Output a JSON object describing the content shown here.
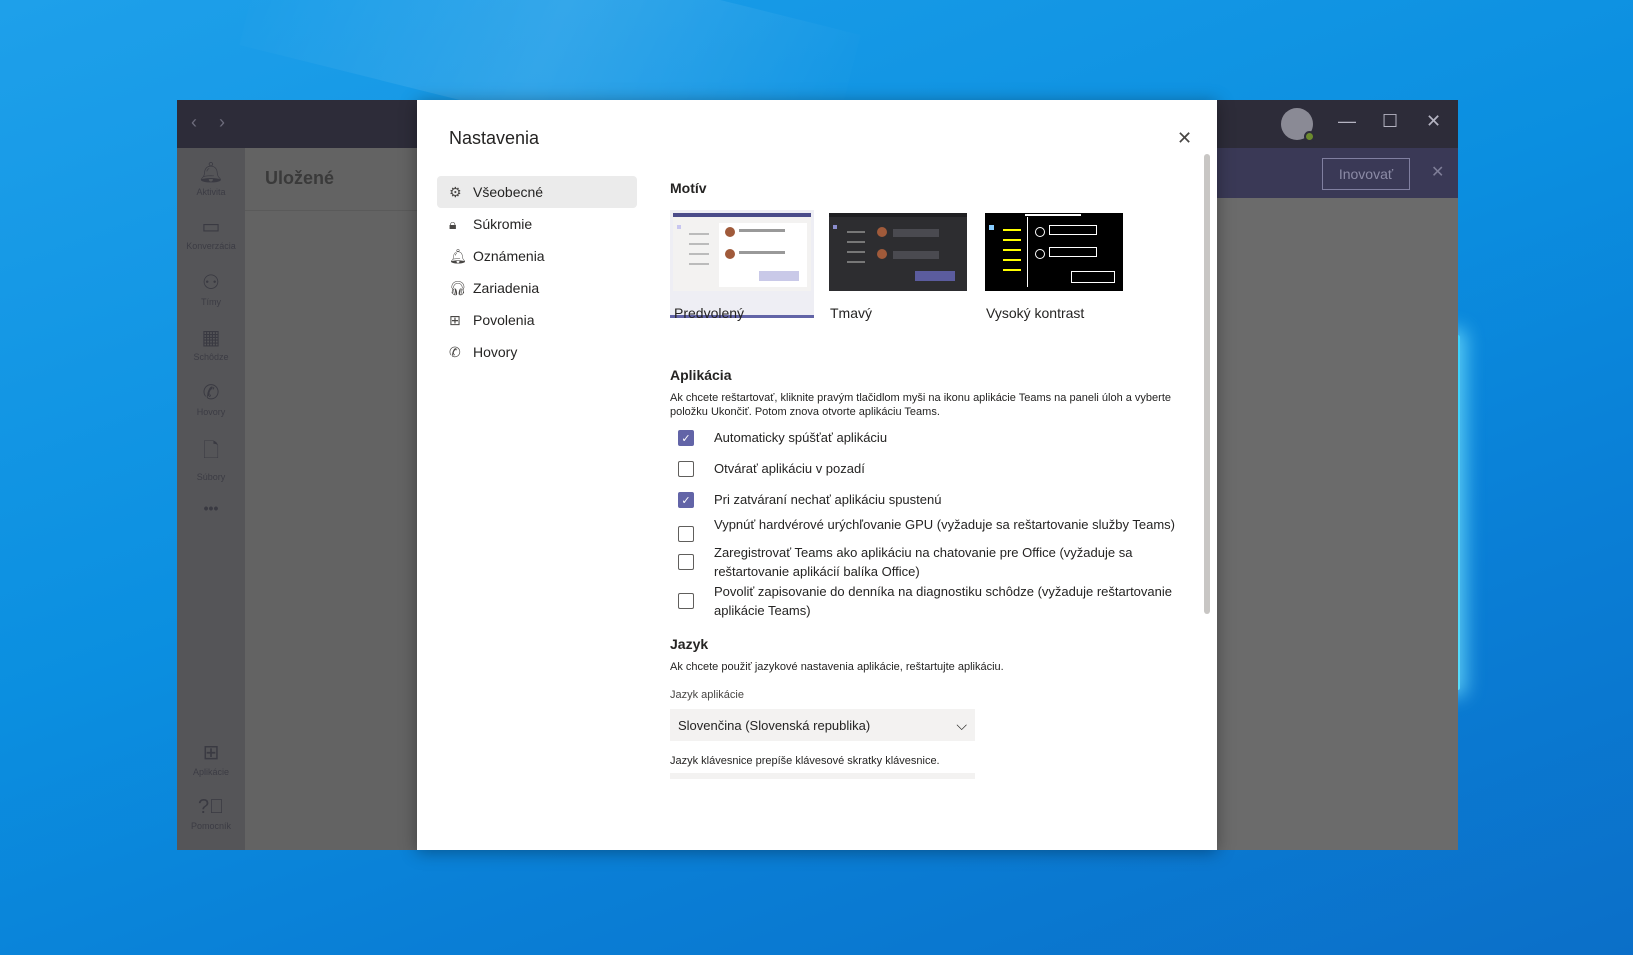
{
  "teams": {
    "rail": [
      {
        "label": "Aktivita",
        "icon": "bell-icon"
      },
      {
        "label": "Konverzácia",
        "icon": "chat-icon"
      },
      {
        "label": "Tímy",
        "icon": "teams-icon"
      },
      {
        "label": "Schôdze",
        "icon": "calendar-icon"
      },
      {
        "label": "Hovory",
        "icon": "phone-icon"
      },
      {
        "label": "Súbory",
        "icon": "file-icon"
      },
      {
        "label": "•••",
        "icon": "more-icon"
      }
    ],
    "rail_bottom": [
      {
        "label": "Aplikácie",
        "icon": "apps-icon"
      },
      {
        "label": "Pomocník",
        "icon": "help-icon"
      }
    ],
    "pane_title": "Uložené",
    "upgrade_label": "Inovovať"
  },
  "dialog": {
    "title": "Nastavenia",
    "nav": [
      {
        "label": "Všeobecné",
        "icon": "gear-icon",
        "active": true
      },
      {
        "label": "Súkromie",
        "icon": "lock-icon"
      },
      {
        "label": "Oznámenia",
        "icon": "bell-icon"
      },
      {
        "label": "Zariadenia",
        "icon": "headset-icon"
      },
      {
        "label": "Povolenia",
        "icon": "gift-icon"
      },
      {
        "label": "Hovory",
        "icon": "phone-icon"
      }
    ],
    "theme": {
      "title": "Motív",
      "options": [
        {
          "label": "Predvolený",
          "selected": true
        },
        {
          "label": "Tmavý",
          "selected": false
        },
        {
          "label": "Vysoký kontrast",
          "selected": false
        }
      ]
    },
    "app": {
      "title": "Aplikácia",
      "description": "Ak chcete reštartovať, kliknite pravým tlačidlom myši na ikonu aplikácie Teams na paneli úloh a vyberte položku Ukončiť. Potom znova otvorte aplikáciu Teams.",
      "options": [
        {
          "label": "Automaticky spúšťať aplikáciu",
          "checked": true
        },
        {
          "label": "Otvárať aplikáciu v pozadí",
          "checked": false
        },
        {
          "label": "Pri zatváraní nechať aplikáciu spustenú",
          "checked": true
        },
        {
          "label": "Vypnúť hardvérové urýchľovanie GPU (vyžaduje sa reštartovanie služby Teams)",
          "checked": false
        },
        {
          "label": "Zaregistrovať Teams ako aplikáciu na chatovanie pre Office (vyžaduje sa reštartovanie aplikácií balíka Office)",
          "checked": false
        },
        {
          "label": "Povoliť zapisovanie do denníka na diagnostiku schôdze (vyžaduje reštartovanie aplikácie Teams)",
          "checked": false
        }
      ]
    },
    "language": {
      "title": "Jazyk",
      "description": "Ak chcete použiť jazykové nastavenia aplikácie, reštartujte aplikáciu.",
      "app_lang_label": "Jazyk aplikácie",
      "app_lang_value": "Slovenčina (Slovenská republika)",
      "keyboard_note": "Jazyk klávesnice prepíše klávesové skratky klávesnice."
    }
  },
  "colors": {
    "accent": "#6264a7",
    "desktop": "#0b8fe0"
  }
}
